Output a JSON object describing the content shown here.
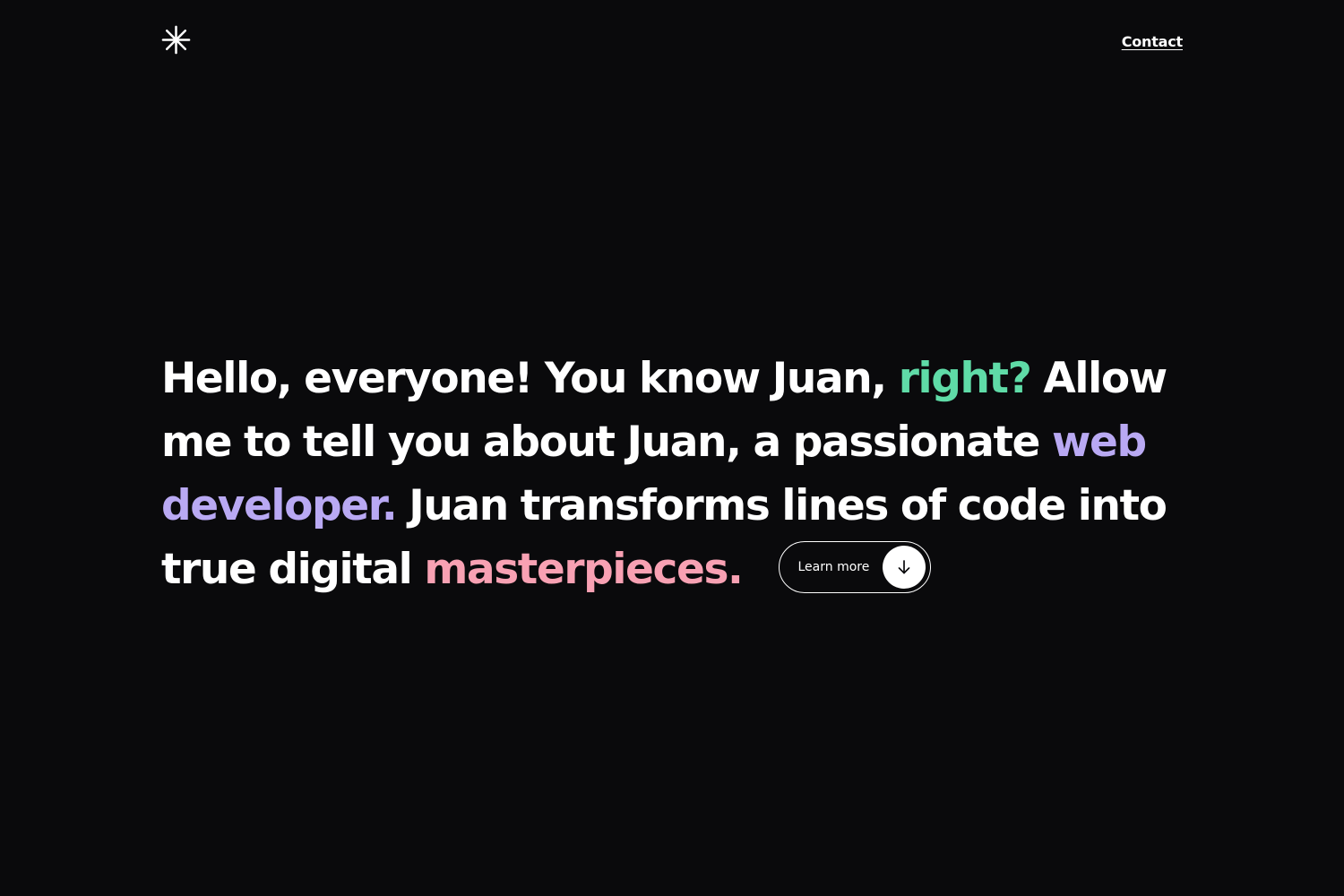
{
  "header": {
    "logo_icon": "asterisk-star-icon",
    "contact_label": "Contact"
  },
  "hero": {
    "segments": [
      {
        "text": "Hello, everyone! You know Juan, ",
        "color": "#ffffff"
      },
      {
        "text": "right?",
        "color": "#5fdba7"
      },
      {
        "text": " Allow me to tell you about Juan, a passionate ",
        "color": "#ffffff"
      },
      {
        "text": "web developer.",
        "color": "#b9a9f3"
      },
      {
        "text": " Juan transforms lines of code into true digital ",
        "color": "#ffffff"
      },
      {
        "text": "masterpieces.",
        "color": "#f8a1b3"
      }
    ],
    "button": {
      "label": "Learn more",
      "icon": "arrow-down-icon"
    }
  },
  "colors": {
    "background": "#0a0a0c",
    "text": "#ffffff",
    "accent_green": "#5fdba7",
    "accent_purple": "#b9a9f3",
    "accent_pink": "#f8a1b3"
  }
}
